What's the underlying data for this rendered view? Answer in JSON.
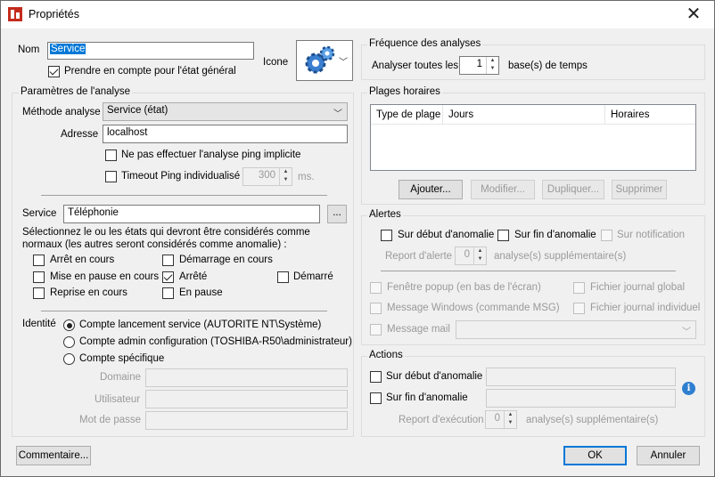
{
  "window": {
    "title": "Propriétés",
    "close_glyph": "✕",
    "app_icon": "app-icon"
  },
  "general": {
    "name_label": "Nom",
    "name_value": "Service",
    "include_label": "Prendre en compte pour l'état général",
    "include_checked": true,
    "icon_label": "Icone",
    "icon": "gears-icon"
  },
  "analysis": {
    "title": "Paramètres de l'analyse",
    "method_label": "Méthode analyse",
    "method_value": "Service (état)",
    "address_label": "Adresse",
    "address_value": "localhost",
    "no_ping_label": "Ne pas effectuer l'analyse ping implicite",
    "timeout_label": "Timeout Ping individualisé",
    "timeout_value": "300",
    "timeout_unit": "ms.",
    "service_label": "Service",
    "service_value": "Téléphonie",
    "browse_label": "...",
    "states_intro": "Sélectionnez le ou les états qui devront être considérés comme normaux (les autres seront considérés comme anomalie) :",
    "states": {
      "stopping": "Arrêt en cours",
      "pausing": "Mise en pause en cours",
      "resuming": "Reprise en cours",
      "starting": "Démarrage en cours",
      "stopped": "Arrêté",
      "paused": "En pause",
      "started": "Démarré"
    },
    "checked_state": "stopped",
    "identity_label": "Identité",
    "identity_options": [
      "Compte lancement service (AUTORITE NT\\Système)",
      "Compte admin configuration (TOSHIBA-R50\\administrateur)",
      "Compte spécifique"
    ],
    "identity_selected": 0,
    "domain_label": "Domaine",
    "user_label": "Utilisateur",
    "password_label": "Mot de passe"
  },
  "frequency": {
    "title": "Fréquence des analyses",
    "prefix": "Analyser toutes les",
    "value": "1",
    "suffix": "base(s) de temps"
  },
  "schedule": {
    "title": "Plages horaires",
    "columns": [
      "Type de plage",
      "Jours",
      "Horaires"
    ],
    "add": "Ajouter...",
    "edit": "Modifier...",
    "duplicate": "Dupliquer...",
    "delete": "Supprimer"
  },
  "alerts": {
    "title": "Alertes",
    "on_start": "Sur début d'anomalie",
    "on_end": "Sur fin d'anomalie",
    "on_notification": "Sur notification",
    "delay_label": "Report d'alerte",
    "delay_value": "0",
    "delay_suffix": "analyse(s) supplémentaire(s)",
    "popup": "Fenêtre popup (en bas de l'écran)",
    "global_log": "Fichier journal global",
    "windows_msg": "Message Windows (commande MSG)",
    "individual_log": "Fichier journal individuel",
    "mail": "Message mail"
  },
  "actions": {
    "title": "Actions",
    "on_start": "Sur début d'anomalie",
    "on_end": "Sur fin d'anomalie",
    "delay_label": "Report d'exécution",
    "delay_value": "0",
    "delay_suffix": "analyse(s) supplémentaire(s)",
    "info_glyph": "i"
  },
  "footer": {
    "comment": "Commentaire...",
    "ok": "OK",
    "cancel": "Annuler"
  }
}
